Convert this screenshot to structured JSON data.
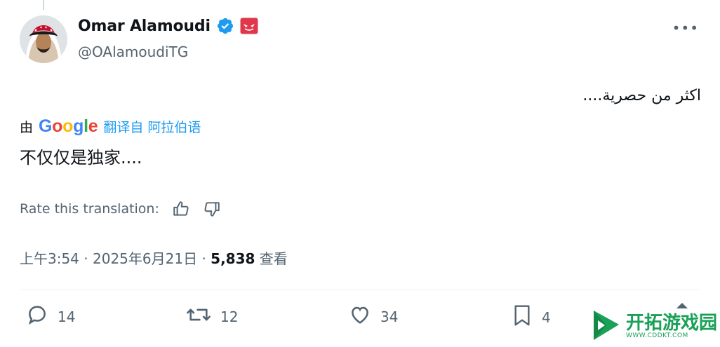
{
  "author": {
    "display_name": "Omar Alamoudi",
    "handle": "@OAlamoudiTG",
    "verified_icon": "verified-badge-icon",
    "affiliate_icon": "affiliate-badge-icon"
  },
  "more_label": "•••",
  "tweet": {
    "original_text": "اكثر من حصرية....",
    "translation": {
      "by_prefix": "由",
      "provider": "Google",
      "link_label": "翻译自 阿拉伯语",
      "text": "不仅仅是独家...."
    },
    "rate": {
      "label": "Rate this translation:",
      "thumbs_up_icon": "thumbs-up-icon",
      "thumbs_down_icon": "thumbs-down-icon"
    },
    "meta": {
      "time": "上午3:54",
      "date": "2025年6月21日",
      "views_count": "5,838",
      "views_label": "查看",
      "sep": "·"
    }
  },
  "actions": {
    "reply": {
      "icon": "reply-icon",
      "count": "14"
    },
    "retweet": {
      "icon": "retweet-icon",
      "count": "12"
    },
    "like": {
      "icon": "heart-icon",
      "count": "34"
    },
    "bookmark": {
      "icon": "bookmark-icon",
      "count": "4"
    }
  },
  "watermark": {
    "title": "开拓游戏园",
    "url": "WWW.CDDKT.COM"
  },
  "colors": {
    "primary_text": "#0f1419",
    "secondary_text": "#536471",
    "link": "#1d9bf0",
    "verified": "#1d9bf0",
    "affiliate": "#e0384b",
    "watermark": "#1aa057"
  }
}
